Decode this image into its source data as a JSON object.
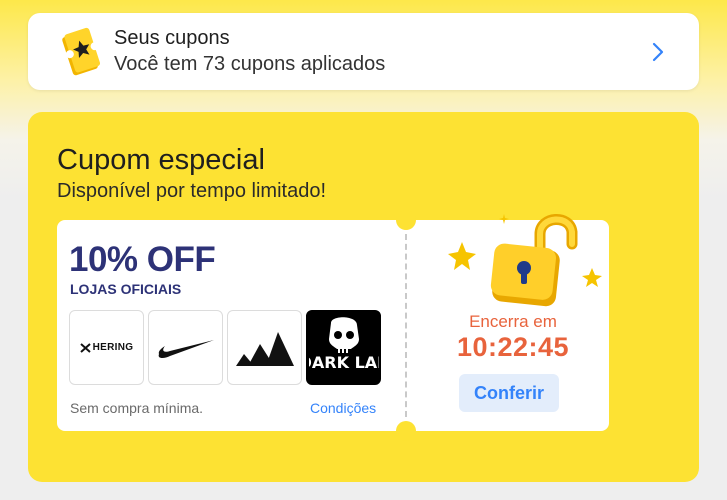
{
  "coupons": {
    "title": "Seus cupons",
    "subtitle": "Você tem 73 cupons aplicados",
    "icon": "ticket-star-icon"
  },
  "special": {
    "title": "Cupom especial",
    "subtitle": "Disponível por tempo limitado!",
    "discount": "10% OFF",
    "stores_label": "LOJAS OFICIAIS",
    "stores": [
      {
        "name": "HERING",
        "icon": "hering-logo"
      },
      {
        "name": "Nike",
        "icon": "nike-swoosh-logo"
      },
      {
        "name": "Adidas",
        "icon": "adidas-logo"
      },
      {
        "name": "DARK LAB",
        "icon": "dark-lab-skull-logo"
      }
    ],
    "min_purchase": "Sem compra mínima.",
    "conditions": "Condições",
    "ends_label": "Encerra em",
    "timer": "10:22:45",
    "cta": "Conferir"
  },
  "colors": {
    "accent_yellow": "#fde233",
    "brand_navy": "#2d3277",
    "timer_orange": "#e8633c",
    "link_blue": "#3483fa"
  }
}
